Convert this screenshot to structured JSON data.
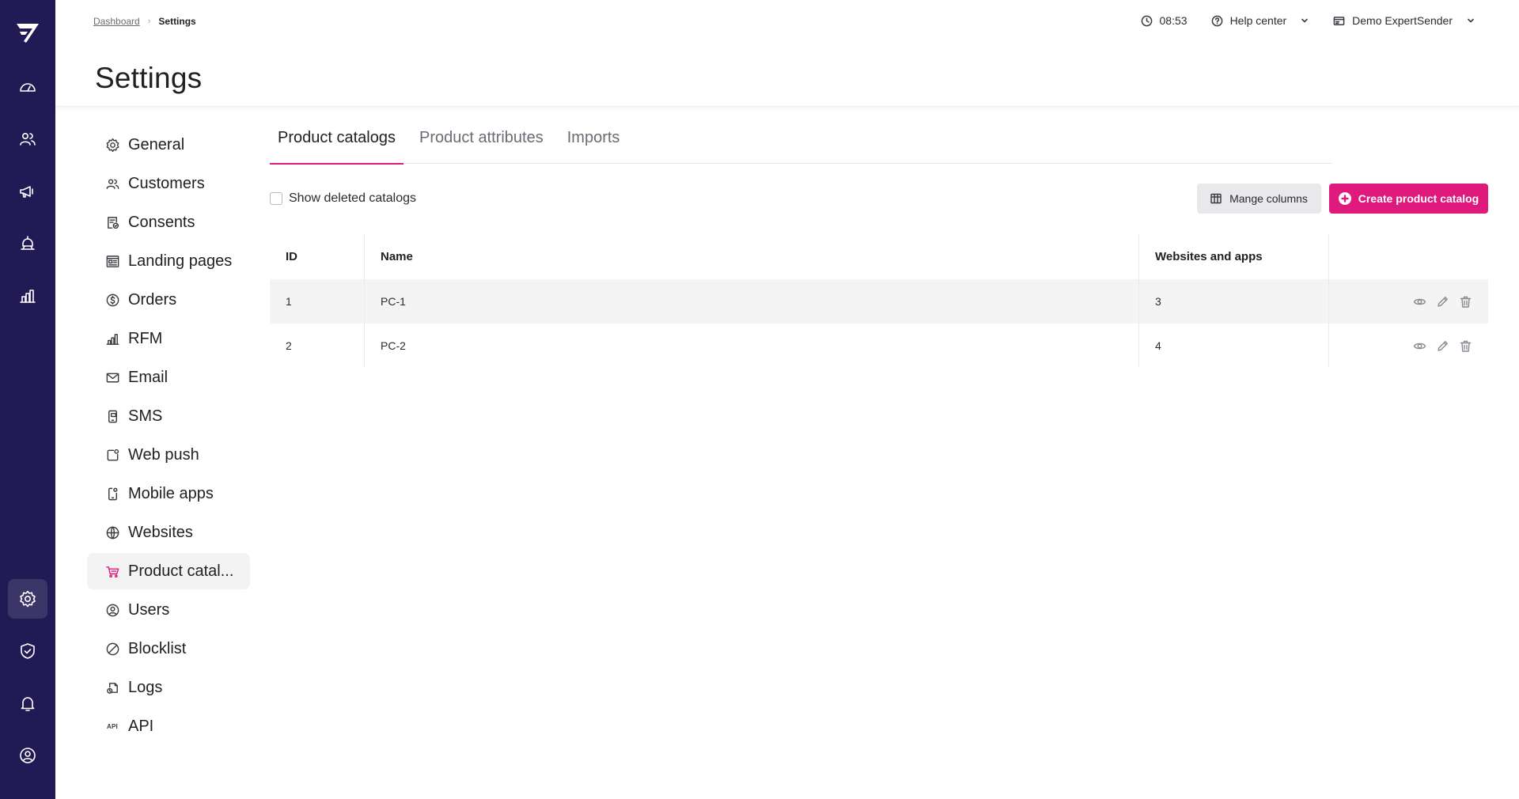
{
  "breadcrumb": {
    "dashboard": "Dashboard",
    "current": "Settings"
  },
  "page": {
    "title": "Settings"
  },
  "topbar": {
    "time": "08:53",
    "help": "Help center",
    "account": "Demo ExpertSender"
  },
  "rail": {
    "icons": [
      "logo",
      "dashboard-icon",
      "customers-icon",
      "campaigns-icon",
      "automation-icon",
      "analytics-icon",
      "settings-icon",
      "security-icon",
      "notifications-icon",
      "profile-icon"
    ],
    "active": "settings-icon"
  },
  "nav": {
    "items": [
      {
        "label": "General",
        "icon": "gear-icon"
      },
      {
        "label": "Customers",
        "icon": "users-icon"
      },
      {
        "label": "Consents",
        "icon": "consent-icon"
      },
      {
        "label": "Landing pages",
        "icon": "landing-page-icon"
      },
      {
        "label": "Orders",
        "icon": "dollar-icon"
      },
      {
        "label": "RFM",
        "icon": "bar-chart-icon"
      },
      {
        "label": "Email",
        "icon": "envelope-icon"
      },
      {
        "label": "SMS",
        "icon": "sms-icon"
      },
      {
        "label": "Web push",
        "icon": "web-push-icon"
      },
      {
        "label": "Mobile apps",
        "icon": "mobile-icon"
      },
      {
        "label": "Websites",
        "icon": "globe-icon"
      },
      {
        "label": "Product catal...",
        "icon": "cart-icon"
      },
      {
        "label": "Users",
        "icon": "user-circle-icon"
      },
      {
        "label": "Blocklist",
        "icon": "block-icon"
      },
      {
        "label": "Logs",
        "icon": "logs-icon"
      },
      {
        "label": "API",
        "icon": "API"
      }
    ],
    "active_index": 11
  },
  "tabs": [
    {
      "label": "Product catalogs"
    },
    {
      "label": "Product attributes"
    },
    {
      "label": "Imports"
    }
  ],
  "toolbar": {
    "checkbox_label": "Show deleted catalogs",
    "checkbox_checked": false,
    "columns_button": "Mange columns",
    "create_button": "Create product catalog"
  },
  "table": {
    "headers": {
      "id": "ID",
      "name": "Name",
      "websites": "Websites and apps"
    },
    "rows": [
      {
        "id": "1",
        "name": "PC-1",
        "websites": "3"
      },
      {
        "id": "2",
        "name": "PC-2",
        "websites": "4"
      }
    ]
  },
  "colors": {
    "rail": "#211a54",
    "accent": "#e0197d",
    "row_highlight": "#f4f4f5"
  }
}
